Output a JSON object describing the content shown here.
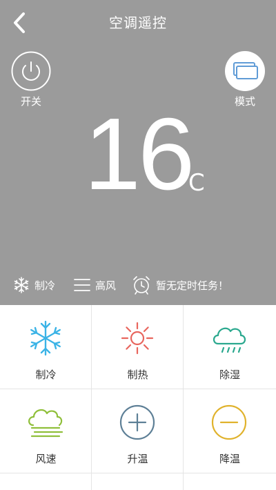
{
  "header": {
    "title": "空调遥控"
  },
  "controls": {
    "power_label": "开关",
    "mode_label": "模式"
  },
  "temperature": {
    "value": "16",
    "unit": "℃"
  },
  "status": {
    "mode": "制冷",
    "fan": "高风",
    "timer": "暂无定时任务！"
  },
  "buttons": [
    {
      "label": "制冷",
      "icon": "snowflake-icon",
      "color": "#3ab3e6"
    },
    {
      "label": "制热",
      "icon": "sun-icon",
      "color": "#e8655d"
    },
    {
      "label": "除湿",
      "icon": "rain-cloud-icon",
      "color": "#2aa88e"
    },
    {
      "label": "风速",
      "icon": "wind-cloud-icon",
      "color": "#8fbf3a"
    },
    {
      "label": "升温",
      "icon": "plus-circle-icon",
      "color": "#5d7f96"
    },
    {
      "label": "降温",
      "icon": "minus-circle-icon",
      "color": "#e0b22b"
    }
  ]
}
